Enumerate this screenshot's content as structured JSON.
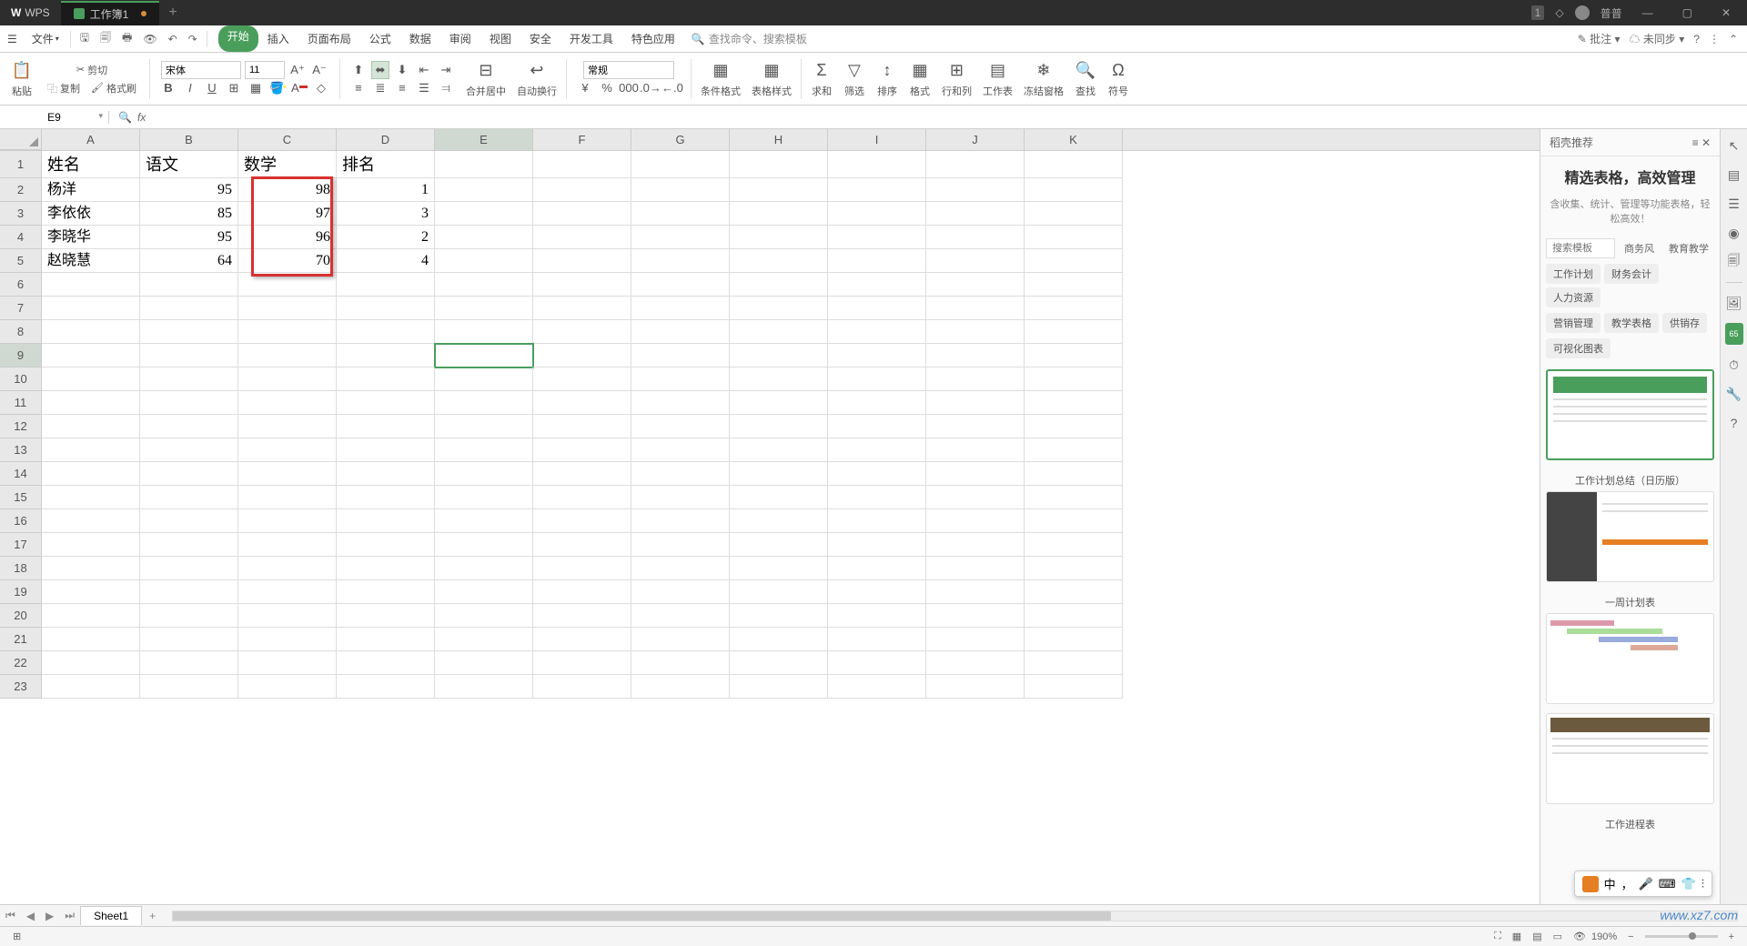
{
  "titlebar": {
    "app": "WPS",
    "tab_name": "工作簿1",
    "user": "普普",
    "notif": "1"
  },
  "menubar": {
    "file": "文件",
    "tabs": [
      "开始",
      "插入",
      "页面布局",
      "公式",
      "数据",
      "审阅",
      "视图",
      "安全",
      "开发工具",
      "特色应用"
    ],
    "search_placeholder": "查找命令、搜索模板",
    "annotate": "批注",
    "unsync": "未同步"
  },
  "ribbon": {
    "paste": "粘贴",
    "cut": "剪切",
    "copy": "复制",
    "fmtpaint": "格式刷",
    "font_name": "宋体",
    "font_size": "11",
    "merge": "合并居中",
    "wrap": "自动换行",
    "numfmt": "常规",
    "condfmt": "条件格式",
    "tablestyle": "表格样式",
    "sum": "求和",
    "filter": "筛选",
    "sort": "排序",
    "format": "格式",
    "rowcol": "行和列",
    "worksheet": "工作表",
    "freeze": "冻结窗格",
    "find": "查找",
    "symbol": "符号"
  },
  "formula": {
    "cellref": "E9",
    "value": ""
  },
  "columns": [
    "A",
    "B",
    "C",
    "D",
    "E",
    "F",
    "G",
    "H",
    "I",
    "J",
    "K"
  ],
  "rows": [
    "1",
    "2",
    "3",
    "4",
    "5",
    "6",
    "7",
    "8",
    "9",
    "10",
    "11",
    "12",
    "13",
    "14",
    "15",
    "16",
    "17",
    "18",
    "19",
    "20",
    "21",
    "22",
    "23"
  ],
  "data": {
    "headers": [
      "姓名",
      "语文",
      "数学",
      "排名"
    ],
    "r2": {
      "A": "杨洋",
      "B": "95",
      "C": "98",
      "D": "1"
    },
    "r3": {
      "A": "李依依",
      "B": "85",
      "C": "97",
      "D": "3"
    },
    "r4": {
      "A": "李晓华",
      "B": "95",
      "C": "96",
      "D": "2"
    },
    "r5": {
      "A": "赵晓慧",
      "B": "64",
      "C": "70",
      "D": "4"
    }
  },
  "rightpane": {
    "header": "稻壳推荐",
    "title": "精选表格，高效管理",
    "subtitle": "含收集、统计、管理等功能表格，轻松高效！",
    "search_ph": "搜索模板",
    "pills": [
      "商务风",
      "教育教学"
    ],
    "cats": [
      "工作计划",
      "财务会计",
      "人力资源",
      "营销管理",
      "教学表格",
      "供销存",
      "可视化图表"
    ],
    "tmpl1": "工作计划总结（日历版）",
    "tmpl2": "一周计划表",
    "tmpl3": "工作进程表"
  },
  "sheettab": "Sheet1",
  "status": {
    "zoom": "190%"
  },
  "ime": {
    "lang": "中",
    "badge": "65"
  },
  "watermark": "www.xz7.com"
}
